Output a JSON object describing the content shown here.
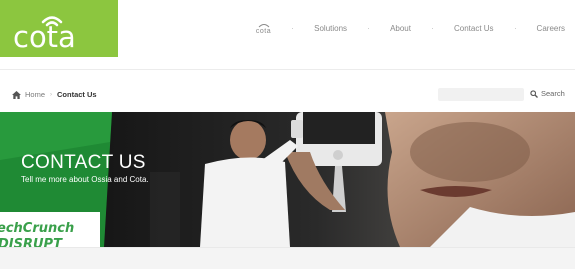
{
  "brand": {
    "logo_text": "cota",
    "logo_bg": "#8cc63f"
  },
  "nav": {
    "mini_logo_text": "cota",
    "items": [
      {
        "label": "Solutions"
      },
      {
        "label": "About"
      },
      {
        "label": "Contact Us"
      },
      {
        "label": "Careers"
      }
    ]
  },
  "breadcrumb": {
    "home_label": "Home",
    "current_label": "Contact Us",
    "home_icon": "home-icon"
  },
  "search": {
    "placeholder": "",
    "button_label": "Search",
    "icon": "search-icon"
  },
  "hero": {
    "title": "CONTACT US",
    "subtitle": "Tell me more about Ossia and Cota.",
    "background_text_line1": "echCrunch",
    "background_text_line2": "DISRUPT",
    "accent_green": "#39b54a"
  }
}
